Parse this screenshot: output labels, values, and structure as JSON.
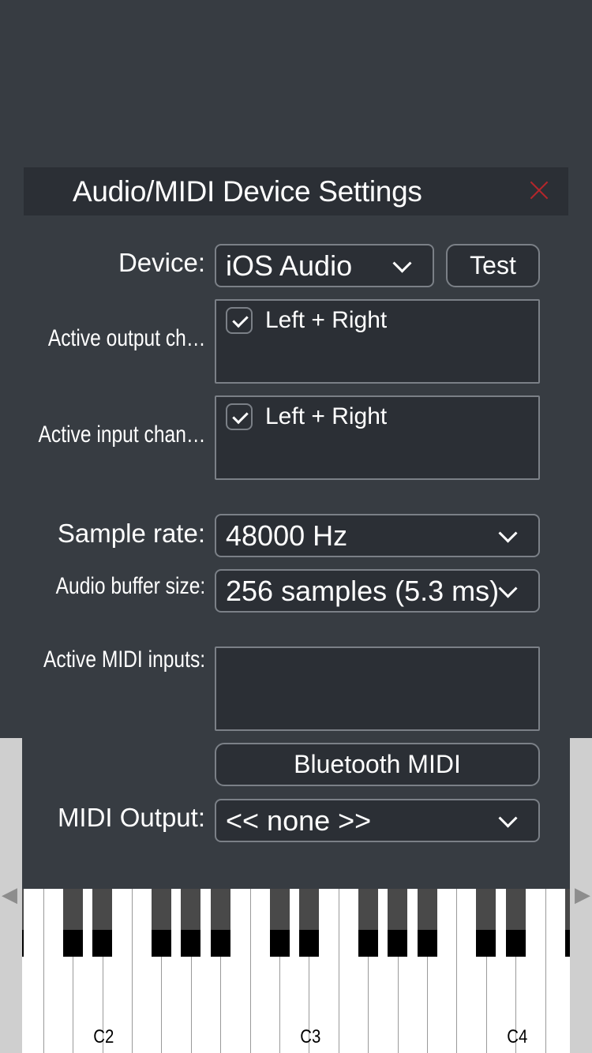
{
  "dialog": {
    "title": "Audio/MIDI Device Settings",
    "close_icon": "close-icon",
    "close_color": "#b3262b"
  },
  "device": {
    "label": "Device:",
    "value": "iOS Audio",
    "test_label": "Test"
  },
  "output_channels": {
    "label": "Active output ch…",
    "items": [
      {
        "label": "Left + Right",
        "checked": true
      }
    ]
  },
  "input_channels": {
    "label": "Active input chan…",
    "items": [
      {
        "label": "Left + Right",
        "checked": true
      }
    ]
  },
  "sample_rate": {
    "label": "Sample rate:",
    "value": "48000 Hz"
  },
  "buffer_size": {
    "label": "Audio buffer size:",
    "value": "256 samples (5.3 ms)"
  },
  "midi_inputs": {
    "label": "Active MIDI inputs:",
    "items": [],
    "bluetooth_label": "Bluetooth MIDI"
  },
  "midi_output": {
    "label": "MIDI Output:",
    "value": "<< none >>"
  },
  "keyboard": {
    "note_labels": [
      "C2",
      "C3",
      "C4"
    ],
    "left_arrow_icon": "arrow-left-icon",
    "right_arrow_icon": "arrow-right-icon"
  },
  "colors": {
    "background": "#373c42",
    "panel": "#2b2f35",
    "border": "#7b8087",
    "text": "#ffffff"
  }
}
